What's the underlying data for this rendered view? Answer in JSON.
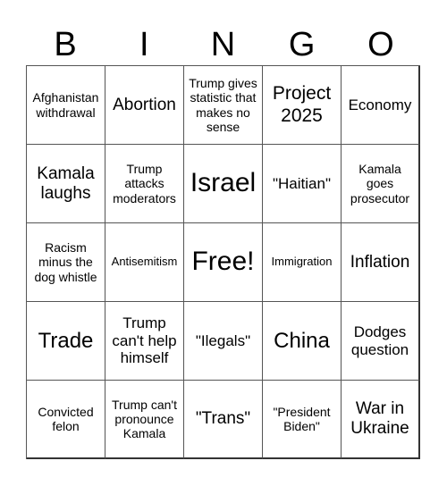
{
  "header": {
    "letters": [
      "B",
      "I",
      "N",
      "G",
      "O"
    ]
  },
  "board": {
    "cells": [
      {
        "text": "Afghanistan withdrawal",
        "size": "fs-s"
      },
      {
        "text": "Abortion",
        "size": "fs-ml"
      },
      {
        "text": "Trump gives statistic that makes no sense",
        "size": "fs-s"
      },
      {
        "text": "Project 2025",
        "size": "fs-l"
      },
      {
        "text": "Economy",
        "size": "fs-m"
      },
      {
        "text": "Kamala laughs",
        "size": "fs-ml"
      },
      {
        "text": "Trump attacks moderators",
        "size": "fs-s"
      },
      {
        "text": "Israel",
        "size": "fs-xxl"
      },
      {
        "text": "\"Haitian\"",
        "size": "fs-m"
      },
      {
        "text": "Kamala goes prosecutor",
        "size": "fs-s"
      },
      {
        "text": "Racism minus the dog whistle",
        "size": "fs-s"
      },
      {
        "text": "Antisemitism",
        "size": "fs-xs"
      },
      {
        "text": "Free!",
        "size": "fs-xxl"
      },
      {
        "text": "Immigration",
        "size": "fs-xs"
      },
      {
        "text": "Inflation",
        "size": "fs-ml"
      },
      {
        "text": "Trade",
        "size": "fs-xl"
      },
      {
        "text": "Trump can't help himself",
        "size": "fs-m"
      },
      {
        "text": "\"Ilegals\"",
        "size": "fs-m"
      },
      {
        "text": "China",
        "size": "fs-xl"
      },
      {
        "text": "Dodges question",
        "size": "fs-m"
      },
      {
        "text": "Convicted felon",
        "size": "fs-s"
      },
      {
        "text": "Trump can't pronounce Kamala",
        "size": "fs-s"
      },
      {
        "text": "\"Trans\"",
        "size": "fs-ml"
      },
      {
        "text": "\"President Biden\"",
        "size": "fs-s"
      },
      {
        "text": "War in Ukraine",
        "size": "fs-ml"
      }
    ]
  }
}
